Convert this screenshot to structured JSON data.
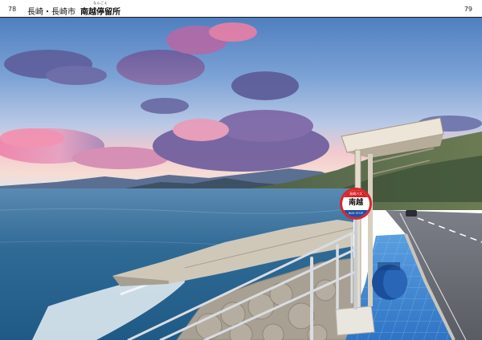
{
  "header": {
    "page_left": "78",
    "page_right": "79",
    "title_region": "長崎・長崎市",
    "title_place": "南越停留所",
    "title_ruby": "なんごえ"
  },
  "sign": {
    "top_text": "長崎バス",
    "name": "南越",
    "bottom_text": "BUS STOP"
  },
  "colors": {
    "sky_top": "#5d8bc6",
    "sunset_pink": "#f1a5b4",
    "sea": "#2f6e97",
    "pavement": "#3c86d0",
    "shelter": "#ece5d8"
  }
}
